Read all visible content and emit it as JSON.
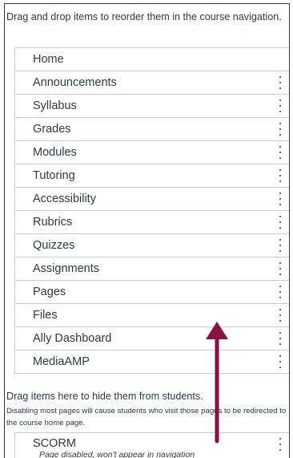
{
  "instructions": "Drag and drop items to reorder them in the course navigation.",
  "nav_items": [
    {
      "label": "Home",
      "has_menu": false
    },
    {
      "label": "Announcements",
      "has_menu": true
    },
    {
      "label": "Syllabus",
      "has_menu": true
    },
    {
      "label": "Grades",
      "has_menu": true
    },
    {
      "label": "Modules",
      "has_menu": true
    },
    {
      "label": "Tutoring",
      "has_menu": true
    },
    {
      "label": "Accessibility",
      "has_menu": true
    },
    {
      "label": "Rubrics",
      "has_menu": true
    },
    {
      "label": "Quizzes",
      "has_menu": true
    },
    {
      "label": "Assignments",
      "has_menu": true
    },
    {
      "label": "Pages",
      "has_menu": true
    },
    {
      "label": "Files",
      "has_menu": true
    },
    {
      "label": "Ally Dashboard",
      "has_menu": true
    },
    {
      "label": "MediaAMP",
      "has_menu": true
    }
  ],
  "hidden_section": {
    "title": "Drag items here to hide them from students.",
    "description": "Disabling most pages will cause students who visit those pages to be redirected to the course home page.",
    "items": [
      {
        "label": "SCORM",
        "status": "Page disabled, won't appear in navigation"
      }
    ]
  },
  "colors": {
    "text": "#2d3b45",
    "border": "#c7cdd1",
    "arrow": "#8b1043"
  },
  "icons": {
    "menu": "vertical-ellipsis-icon",
    "overlay": "up-arrow-icon"
  }
}
